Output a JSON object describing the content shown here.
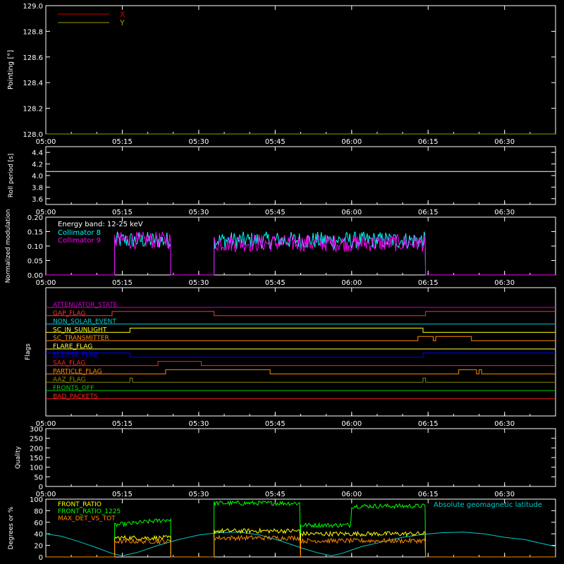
{
  "time_ticks": [
    "05:00",
    "05:15",
    "05:30",
    "05:45",
    "06:00",
    "06:15",
    "06:30"
  ],
  "chart_data": [
    {
      "type": "line",
      "ylabel": "Pointing [°]",
      "ylim": [
        128.0,
        129.0
      ],
      "yticks": [
        "128.0",
        "128.2",
        "128.4",
        "128.6",
        "128.8",
        "129.0"
      ],
      "legend": [
        {
          "name": "X",
          "color": "#cc0000"
        },
        {
          "name": "Y",
          "color": "#999900"
        }
      ],
      "series": [
        {
          "name": "X",
          "color": "#cc0000",
          "points": [
            [
              0,
              128.0
            ],
            [
              100,
              128.0
            ]
          ]
        },
        {
          "name": "Y",
          "color": "#999900",
          "points": [
            [
              0,
              128.0
            ],
            [
              100,
              128.0
            ]
          ]
        }
      ]
    },
    {
      "type": "line",
      "ylabel": "Roll period [s]",
      "ylim": [
        3.5,
        4.5
      ],
      "yticks": [
        "3.6",
        "3.8",
        "4.0",
        "4.2",
        "4.4"
      ],
      "series": [
        {
          "name": "roll",
          "color": "#ffffff",
          "points": [
            [
              0,
              4.07
            ],
            [
              100,
              4.07
            ]
          ]
        }
      ]
    },
    {
      "type": "line",
      "ylabel": "Normalized modulation",
      "ylim": [
        0.0,
        0.2
      ],
      "yticks": [
        "0.00",
        "0.05",
        "0.10",
        "0.15",
        "0.20"
      ],
      "annotation": "Energy band: 12-25 keV",
      "legend": [
        {
          "name": "Collimator 8",
          "color": "#00ffff"
        },
        {
          "name": "Collimator 9",
          "color": "#ff00ff"
        }
      ],
      "segments": [
        {
          "start": 13.5,
          "end": 24.5,
          "c8": 0.12,
          "c9": 0.12
        },
        {
          "start": 33.0,
          "end": 74.5,
          "c8": 0.12,
          "c9": 0.11
        }
      ]
    },
    {
      "type": "line",
      "ylabel": "Flags",
      "flags": [
        {
          "name": "ATTENUATOR_STATE",
          "color": "#cc00cc",
          "steps": [
            [
              0,
              0
            ],
            [
              100,
              0
            ]
          ]
        },
        {
          "name": "GAP_FLAG",
          "color": "#ff3333",
          "steps": [
            [
              0,
              0
            ],
            [
              13,
              1
            ],
            [
              33,
              0
            ],
            [
              74.5,
              1
            ]
          ]
        },
        {
          "name": "NON_SOLAR_EVENT",
          "color": "#00cccc",
          "steps": [
            [
              0,
              0
            ],
            [
              100,
              0
            ]
          ]
        },
        {
          "name": "SC_IN_SUNLIGHT",
          "color": "#ffff00",
          "steps": [
            [
              0,
              0
            ],
            [
              16.5,
              1
            ],
            [
              74,
              0
            ]
          ]
        },
        {
          "name": "SC_TRANSMITTER",
          "color": "#ff8800",
          "steps": [
            [
              0,
              0
            ],
            [
              73,
              1
            ],
            [
              76,
              0
            ],
            [
              76.5,
              1
            ],
            [
              83.5,
              0
            ]
          ]
        },
        {
          "name": "FLARE_FLAG",
          "color": "#ffff44",
          "steps": [
            [
              0,
              0
            ],
            [
              100,
              0
            ]
          ]
        },
        {
          "name": "ECLIPSE_FLAG",
          "color": "#0000ff",
          "steps": [
            [
              0,
              1
            ],
            [
              16.5,
              0
            ],
            [
              74,
              1
            ]
          ]
        },
        {
          "name": "SAA_FLAG",
          "color": "#ff2222",
          "steps": [
            [
              0,
              0
            ],
            [
              22,
              1
            ],
            [
              30.5,
              0
            ]
          ]
        },
        {
          "name": "PARTICLE_FLAG",
          "color": "#ff8800",
          "steps": [
            [
              0,
              0
            ],
            [
              23.5,
              1
            ],
            [
              44,
              0
            ],
            [
              81,
              1
            ],
            [
              84.5,
              0
            ],
            [
              85,
              1
            ],
            [
              85.5,
              0
            ]
          ]
        },
        {
          "name": "AAZ_FLAG",
          "color": "#888800",
          "steps": [
            [
              0,
              0
            ],
            [
              16.5,
              1
            ],
            [
              17,
              0
            ],
            [
              74,
              1
            ],
            [
              74.5,
              0
            ]
          ]
        },
        {
          "name": "FRONTS_OFF",
          "color": "#00cc00",
          "steps": [
            [
              0,
              0
            ],
            [
              100,
              0
            ]
          ]
        },
        {
          "name": "BAD_PACKETS",
          "color": "#ff2222",
          "steps": [
            [
              0,
              0
            ],
            [
              100,
              0
            ]
          ]
        }
      ]
    },
    {
      "type": "line",
      "ylabel": "Quality",
      "ylim": [
        0,
        300
      ],
      "yticks": [
        "0",
        "50",
        "100",
        "150",
        "200",
        "250",
        "300"
      ],
      "series": []
    },
    {
      "type": "line",
      "ylabel": "Degrees or %",
      "ylim": [
        0,
        100
      ],
      "yticks": [
        "0",
        "20",
        "40",
        "60",
        "80",
        "100"
      ],
      "legend": [
        {
          "name": "FRONT_RATIO",
          "color": "#ffff00"
        },
        {
          "name": "FRONT_RATIO_1225",
          "color": "#00ff00"
        },
        {
          "name": "MAX_DET_VS_TOT",
          "color": "#ff8800"
        }
      ],
      "right_label": {
        "name": "Absolute geomagnetic latitude",
        "color": "#00cccc"
      },
      "latitude": [
        [
          0,
          40
        ],
        [
          3,
          36
        ],
        [
          6,
          28
        ],
        [
          10,
          16
        ],
        [
          13,
          6
        ],
        [
          15,
          2
        ],
        [
          18,
          8
        ],
        [
          22,
          20
        ],
        [
          26,
          30
        ],
        [
          30,
          38
        ],
        [
          34,
          42
        ],
        [
          38,
          43
        ],
        [
          42,
          38
        ],
        [
          46,
          28
        ],
        [
          50,
          16
        ],
        [
          53,
          8
        ],
        [
          56,
          2
        ],
        [
          58,
          6
        ],
        [
          62,
          18
        ],
        [
          66,
          26
        ],
        [
          70,
          34
        ],
        [
          74,
          39
        ],
        [
          78,
          42
        ],
        [
          82,
          43
        ],
        [
          86,
          40
        ],
        [
          90,
          34
        ],
        [
          94,
          30
        ],
        [
          98,
          22
        ],
        [
          100,
          18
        ]
      ],
      "segments": [
        {
          "start": 13.5,
          "end": 24.5,
          "fr": 33,
          "fr1225": 55,
          "mdt": 27,
          "fr1225_end": 65
        },
        {
          "start": 33.0,
          "end": 50.0,
          "fr": 45,
          "fr1225": 93,
          "mdt": 33
        },
        {
          "start": 50.0,
          "end": 74.5,
          "fr": 40,
          "fr1225": 55,
          "mdt": 28,
          "frmid": 88,
          "midstart": 74.5
        }
      ]
    }
  ]
}
